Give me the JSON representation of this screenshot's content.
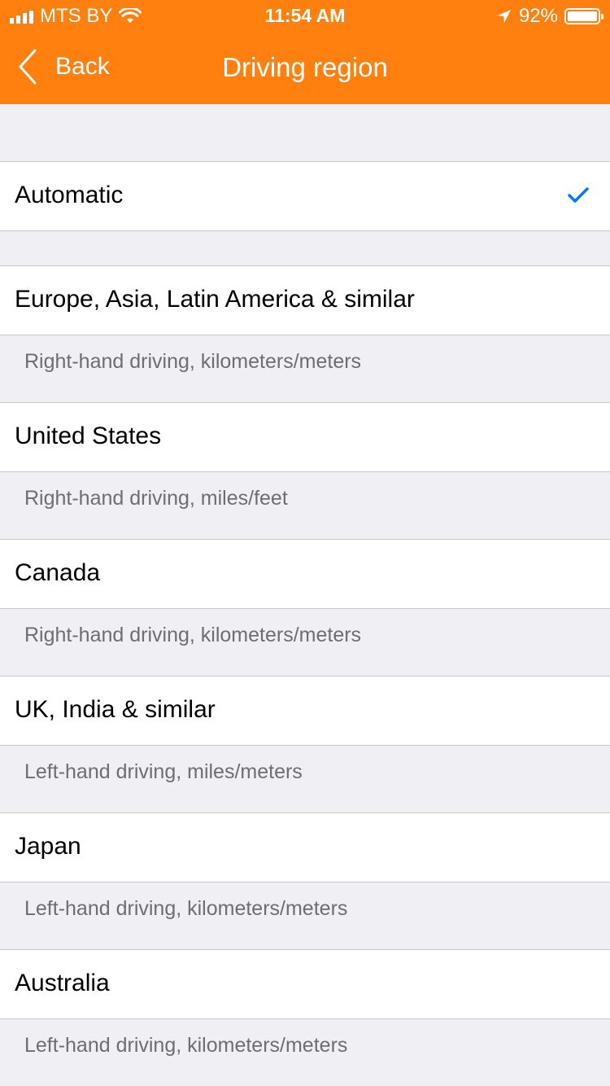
{
  "status_bar": {
    "carrier": "MTS BY",
    "time": "11:54 AM",
    "battery": "92%"
  },
  "nav": {
    "back_label": "Back",
    "title": "Driving region"
  },
  "colors": {
    "accent": "#ff7f0f",
    "check": "#007aff"
  },
  "regions": [
    {
      "label": "Automatic",
      "description": "",
      "selected": true
    },
    {
      "label": "Europe, Asia, Latin America & similar",
      "description": "Right-hand driving, kilometers/meters",
      "selected": false
    },
    {
      "label": "United States",
      "description": "Right-hand driving, miles/feet",
      "selected": false
    },
    {
      "label": "Canada",
      "description": "Right-hand driving, kilometers/meters",
      "selected": false
    },
    {
      "label": "UK, India & similar",
      "description": "Left-hand driving, miles/meters",
      "selected": false
    },
    {
      "label": "Japan",
      "description": "Left-hand driving, kilometers/meters",
      "selected": false
    },
    {
      "label": "Australia",
      "description": "Left-hand driving, kilometers/meters",
      "selected": false
    }
  ]
}
